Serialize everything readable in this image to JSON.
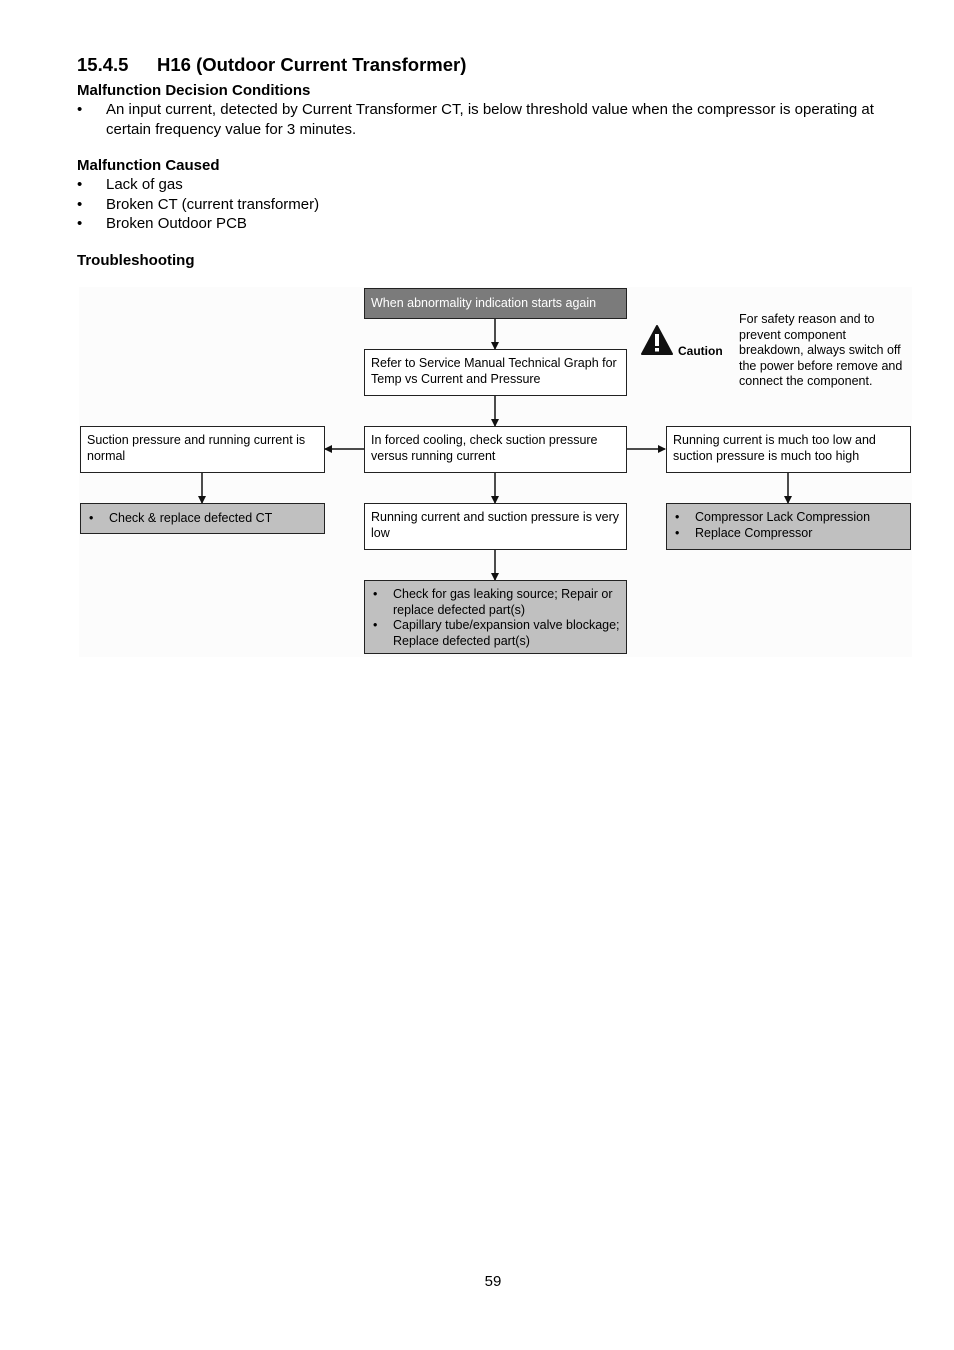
{
  "section": {
    "number": "15.4.5",
    "title": "H16 (Outdoor Current Transformer)"
  },
  "decision_conditions": {
    "heading": "Malfunction Decision Conditions",
    "items": [
      "An input current, detected by Current Transformer CT, is below threshold value when the compressor is operating at certain frequency value for 3 minutes."
    ]
  },
  "caused": {
    "heading": "Malfunction Caused",
    "items": [
      "Lack of gas",
      "Broken CT (current transformer)",
      "Broken Outdoor PCB"
    ]
  },
  "troubleshooting": {
    "heading": "Troubleshooting",
    "bullet": "•",
    "caution": {
      "icon": "warning-triangle-icon",
      "label": "Caution",
      "text": "For safety reason and to prevent component breakdown, always switch off the power before remove and connect the component."
    },
    "nodes": {
      "start": "When abnormality indication starts again",
      "refer": "Refer to Service Manual Technical Graph for Temp vs Current and Pressure",
      "check": "In forced cooling, check suction pressure versus running current",
      "normal": "Suction pressure and running current is normal",
      "normal_action": [
        "Check & replace defected CT"
      ],
      "very_low": "Running current and suction pressure is very low",
      "very_low_action": [
        "Check for gas leaking source; Repair or replace defected part(s)",
        "Capillary tube/expansion valve blockage; Replace defected part(s)"
      ],
      "high": "Running current is much too low and suction pressure is much too high",
      "high_action": [
        "Compressor Lack Compression",
        "Replace Compressor"
      ]
    }
  },
  "page_number": "59"
}
